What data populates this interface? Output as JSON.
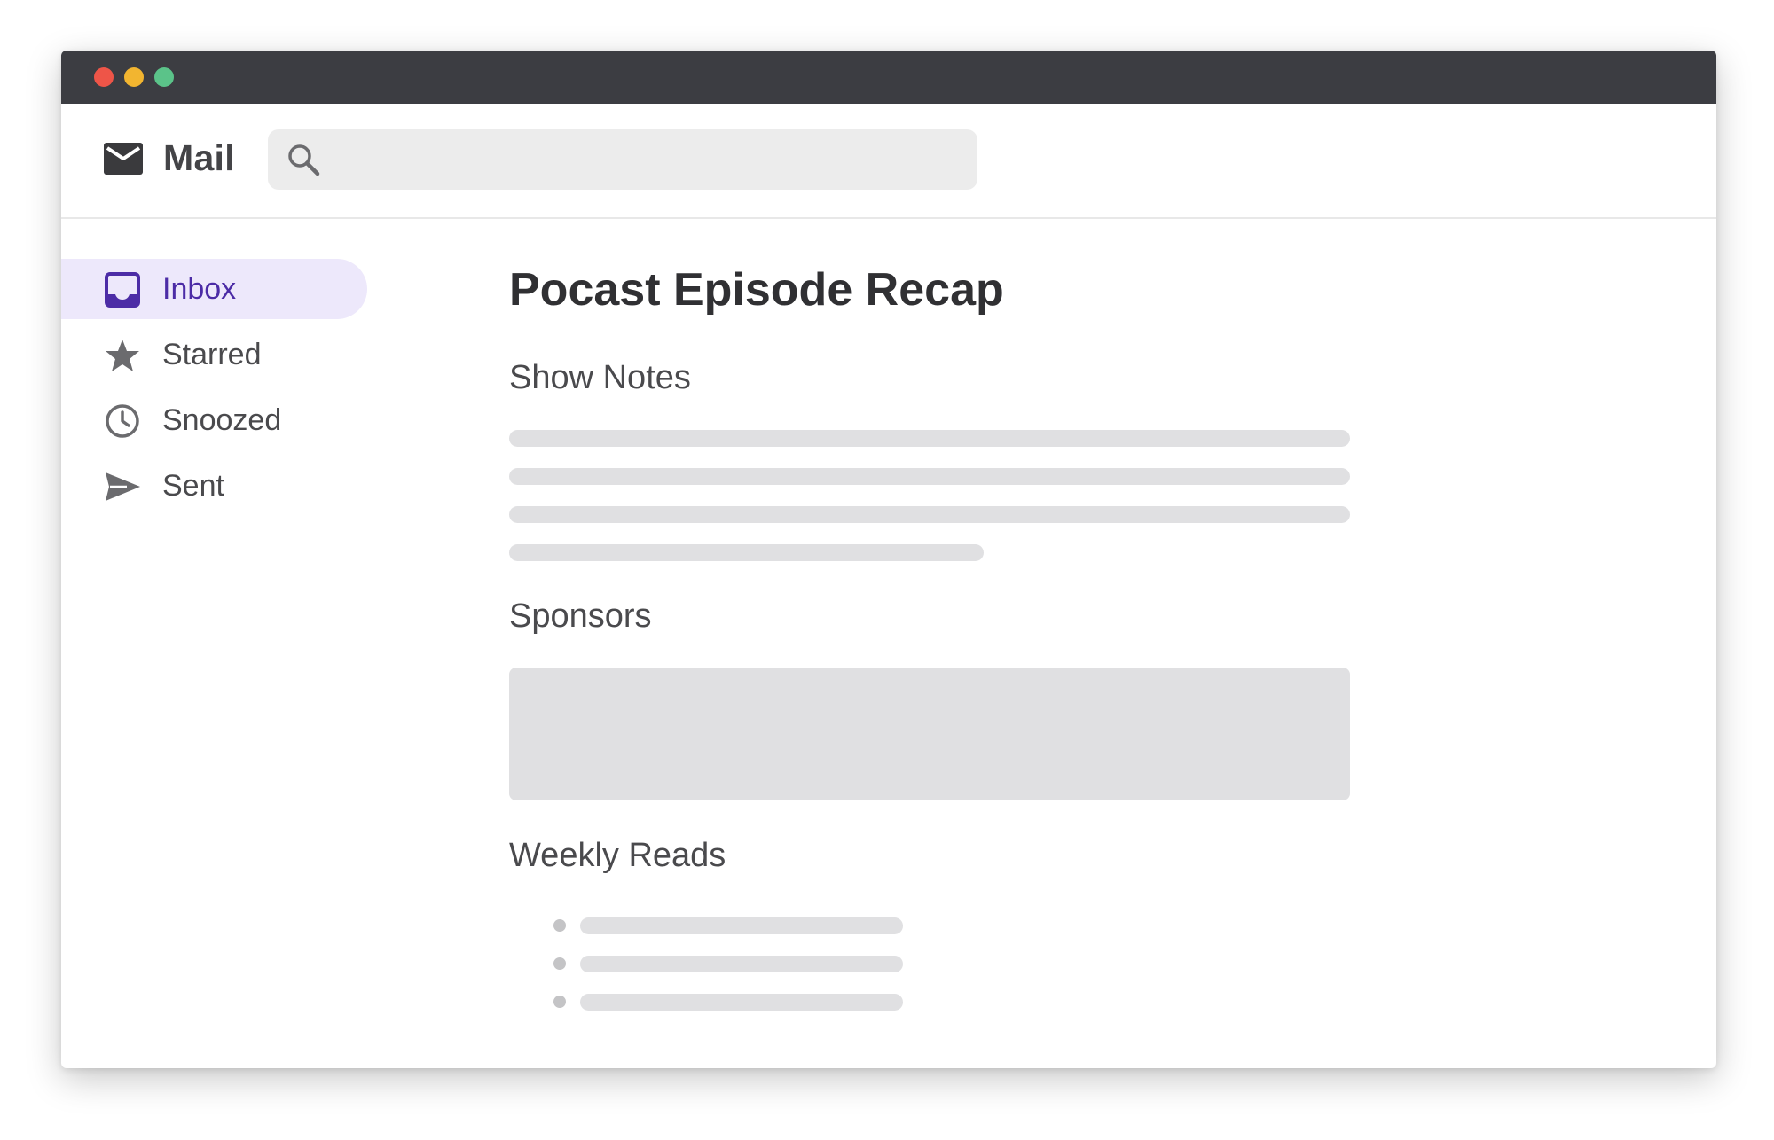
{
  "window": {
    "controls": [
      {
        "name": "close",
        "color": "#ee5548"
      },
      {
        "name": "minimize",
        "color": "#f2b530"
      },
      {
        "name": "zoom",
        "color": "#5bc389"
      }
    ]
  },
  "app": {
    "title": "Mail",
    "logo_icon": "envelope-icon"
  },
  "search": {
    "icon": "search-icon",
    "value": "",
    "placeholder": ""
  },
  "sidebar": {
    "items": [
      {
        "label": "Inbox",
        "icon": "inbox-icon",
        "active": true
      },
      {
        "label": "Starred",
        "icon": "star-icon",
        "active": false
      },
      {
        "label": "Snoozed",
        "icon": "clock-icon",
        "active": false
      },
      {
        "label": "Sent",
        "icon": "send-icon",
        "active": false
      }
    ]
  },
  "message": {
    "subject": "Pocast Episode Recap",
    "sections": {
      "show_notes": "Show Notes",
      "sponsors": "Sponsors",
      "weekly_reads": "Weekly Reads"
    }
  },
  "colors": {
    "titlebar": "#3c3d42",
    "accent": "#4c2ca6",
    "active_bg": "#ede8fb",
    "placeholder": "#e0e0e2"
  }
}
